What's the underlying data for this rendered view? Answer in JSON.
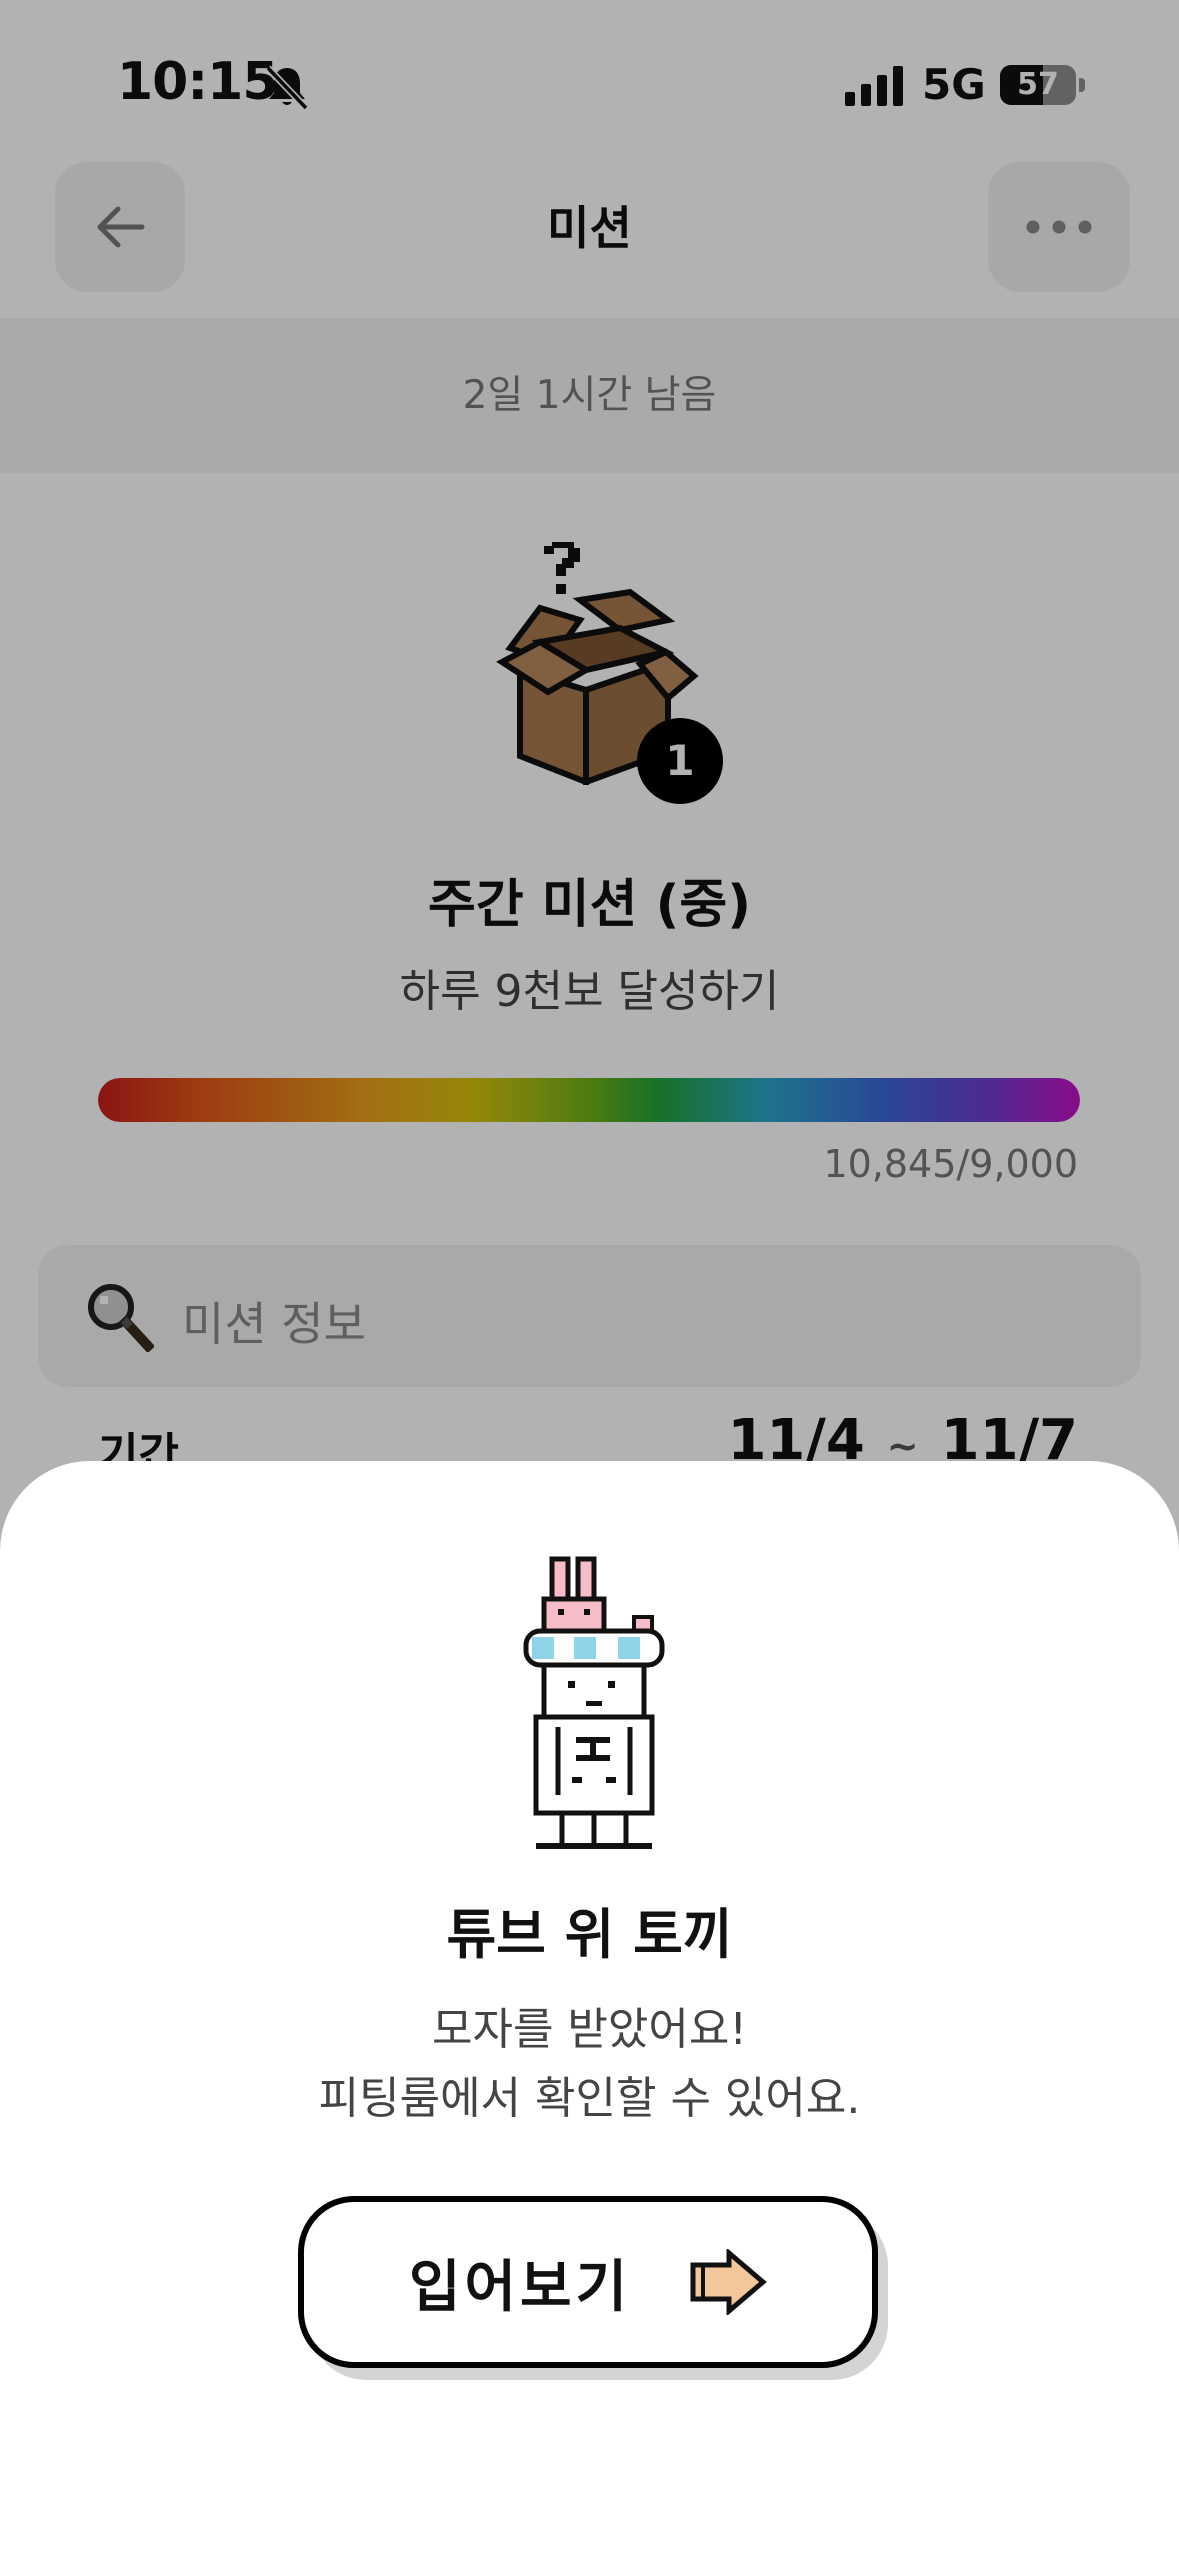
{
  "status": {
    "time": "10:15",
    "network": "5G",
    "battery": "57",
    "battery_level_percent": 57
  },
  "header": {
    "title": "미션",
    "back_icon": "arrow-left-icon",
    "more_icon": "ellipsis-icon"
  },
  "mission": {
    "time_remaining": "2일 1시간 남음",
    "reward_count": "1",
    "title": "주간 미션 (중)",
    "description": "하루 9천보 달성하기",
    "progress_text": "10,845/9,000",
    "progress_fraction": 1.0,
    "info_label": "미션 정보",
    "period_label": "기간",
    "period_start": "11/4",
    "period_separator": "~",
    "period_end": "11/7"
  },
  "sheet": {
    "title": "튜브 위 토끼",
    "message_line1": "모자를 받았어요!",
    "message_line2": "피팅룸에서 확인할 수 있어요.",
    "button_label": "입어보기"
  },
  "colors": {
    "overlay": "rgba(0,0,0,0.30)",
    "box_brown": "#a87a4e",
    "pointer_skin": "#f3c79a"
  }
}
